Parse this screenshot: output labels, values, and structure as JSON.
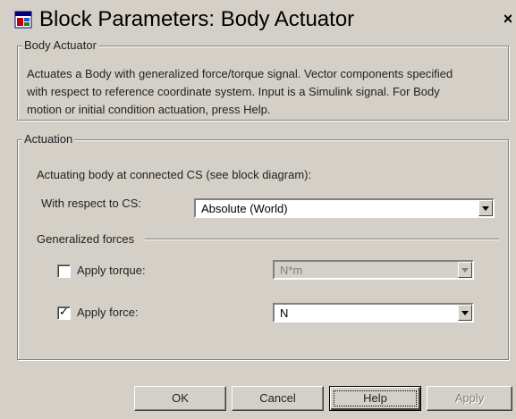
{
  "window": {
    "title": "Block Parameters: Body Actuator",
    "close_glyph": "×"
  },
  "body_actuator_group": {
    "label": "Body Actuator",
    "description": "Actuates a Body with generalized force/torque signal. Vector components specified\nwith respect to reference coordinate system. Input is a Simulink signal. For Body\nmotion or initial condition actuation, press Help."
  },
  "actuation_group": {
    "label": "Actuation",
    "connected_cs_text": "Actuating body at connected CS (see block diagram):",
    "respect_label": "With respect to CS:",
    "respect_value": "Absolute (World)",
    "generalized_forces_label": "Generalized forces",
    "torque": {
      "label": "Apply torque:",
      "checked": false,
      "unit": "N*m",
      "enabled": false
    },
    "force": {
      "label": "Apply force:",
      "checked": true,
      "check_glyph": "✓",
      "unit": "N",
      "enabled": true
    }
  },
  "buttons": {
    "ok": "OK",
    "cancel": "Cancel",
    "help": "Help",
    "apply": "Apply"
  },
  "icons": {
    "title": "simulink-block-icon",
    "close": "close-icon"
  }
}
